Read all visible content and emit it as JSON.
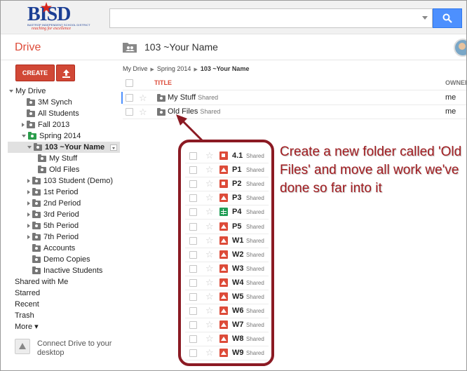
{
  "logo": {
    "brand": "BISD",
    "district": "BASTROP INDEPENDENT SCHOOL DISTRICT",
    "tagline": "reaching for excellence"
  },
  "app": {
    "title": "Drive"
  },
  "header": {
    "folder_title": "103 ~Your Name"
  },
  "toolbar": {
    "create_label": "CREATE"
  },
  "breadcrumb": {
    "root": "My Drive",
    "parent": "Spring 2014",
    "current": "103 ~Your Name"
  },
  "columns": {
    "title": "TITLE",
    "owner": "OWNER"
  },
  "sidebar": {
    "tree": [
      {
        "label": "My Drive",
        "indent": 0,
        "toggle": "down",
        "folder": "none"
      },
      {
        "label": "3M Synch",
        "indent": 1,
        "toggle": "none",
        "folder": "shared"
      },
      {
        "label": "All Students",
        "indent": 1,
        "toggle": "none",
        "folder": "shared"
      },
      {
        "label": "Fall 2013",
        "indent": 1,
        "toggle": "right",
        "folder": "shared"
      },
      {
        "label": "Spring 2014",
        "indent": 1,
        "toggle": "down",
        "folder": "green"
      },
      {
        "label": "103 ~Your Name",
        "indent": 2,
        "toggle": "down",
        "folder": "shared",
        "selected": true
      },
      {
        "label": "My Stuff",
        "indent": 3,
        "toggle": "none",
        "folder": "shared"
      },
      {
        "label": "Old Files",
        "indent": 3,
        "toggle": "none",
        "folder": "shared"
      },
      {
        "label": "103 Student (Demo)",
        "indent": 2,
        "toggle": "right",
        "folder": "shared"
      },
      {
        "label": "1st Period",
        "indent": 2,
        "toggle": "right",
        "folder": "shared"
      },
      {
        "label": "2nd Period",
        "indent": 2,
        "toggle": "right",
        "folder": "shared"
      },
      {
        "label": "3rd Period",
        "indent": 2,
        "toggle": "right",
        "folder": "shared"
      },
      {
        "label": "5th Period",
        "indent": 2,
        "toggle": "right",
        "folder": "shared"
      },
      {
        "label": "7th Period",
        "indent": 2,
        "toggle": "right",
        "folder": "shared"
      },
      {
        "label": "Accounts",
        "indent": 2,
        "toggle": "none",
        "folder": "shared"
      },
      {
        "label": "Demo Copies",
        "indent": 2,
        "toggle": "none",
        "folder": "shared"
      },
      {
        "label": "Inactive Students",
        "indent": 2,
        "toggle": "none",
        "folder": "shared"
      }
    ],
    "links": [
      "Shared with Me",
      "Starred",
      "Recent",
      "Trash",
      "More ▾"
    ],
    "connect": "Connect Drive to your desktop"
  },
  "files": [
    {
      "name": "My Stuff",
      "badge": "Shared",
      "owner": "me"
    },
    {
      "name": "Old Files",
      "badge": "Shared",
      "owner": "me"
    }
  ],
  "popup_files": [
    {
      "name": "4.1",
      "badge": "Shared",
      "icon": "multi"
    },
    {
      "name": "P1",
      "badge": "Shared",
      "icon": "red"
    },
    {
      "name": "P2",
      "badge": "Shared",
      "icon": "multi"
    },
    {
      "name": "P3",
      "badge": "Shared",
      "icon": "red"
    },
    {
      "name": "P4",
      "badge": "Shared",
      "icon": "green"
    },
    {
      "name": "P5",
      "badge": "Shared",
      "icon": "red"
    },
    {
      "name": "W1",
      "badge": "Shared",
      "icon": "red"
    },
    {
      "name": "W2",
      "badge": "Shared",
      "icon": "red"
    },
    {
      "name": "W3",
      "badge": "Shared",
      "icon": "red"
    },
    {
      "name": "W4",
      "badge": "Shared",
      "icon": "red"
    },
    {
      "name": "W5",
      "badge": "Shared",
      "icon": "red"
    },
    {
      "name": "W6",
      "badge": "Shared",
      "icon": "red"
    },
    {
      "name": "W7",
      "badge": "Shared",
      "icon": "red"
    },
    {
      "name": "W8",
      "badge": "Shared",
      "icon": "red"
    },
    {
      "name": "W9",
      "badge": "Shared",
      "icon": "red"
    }
  ],
  "callout": "Create a new folder called 'Old Files' and move all work we've done so far into it",
  "colors": {
    "accent_red": "#dd4b39",
    "search_blue": "#4d90fe",
    "callout_red": "#a11c20",
    "border_maroon": "#8b1a23"
  }
}
